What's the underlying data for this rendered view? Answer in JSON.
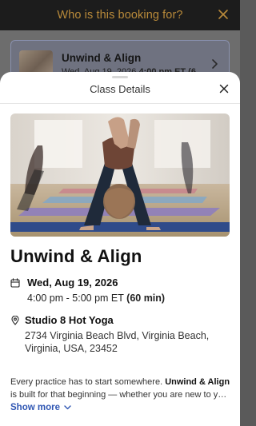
{
  "header": {
    "title": "Who is this booking for?",
    "close_icon": "close-icon"
  },
  "booking_card": {
    "title": "Unwind & Align",
    "date_text": "Wed, Aug 19, 2026",
    "time_text": "4:00 pm ET (6",
    "chevron_icon": "chevron-right-icon"
  },
  "sheet": {
    "title": "Class Details",
    "close_icon": "close-icon"
  },
  "class": {
    "name": "Unwind & Align",
    "date": "Wed, Aug 19, 2026",
    "time_range": "4:00 pm - 5:00 pm ET",
    "duration": "(60 min)",
    "studio": "Studio 8 Hot Yoga",
    "address": "2734 Virginia Beach Blvd, Virginia Beach, Virginia, USA, 23452"
  },
  "description": {
    "intro": "Every practice has to start somewhere. ",
    "class_name": "Unwind & Align",
    "rest": " is built for that beginning — whether you are new to yog…"
  },
  "show_more": {
    "label": "Show more"
  },
  "colors": {
    "accent_gold": "#b98a3a",
    "link_blue": "#2f56b3"
  }
}
